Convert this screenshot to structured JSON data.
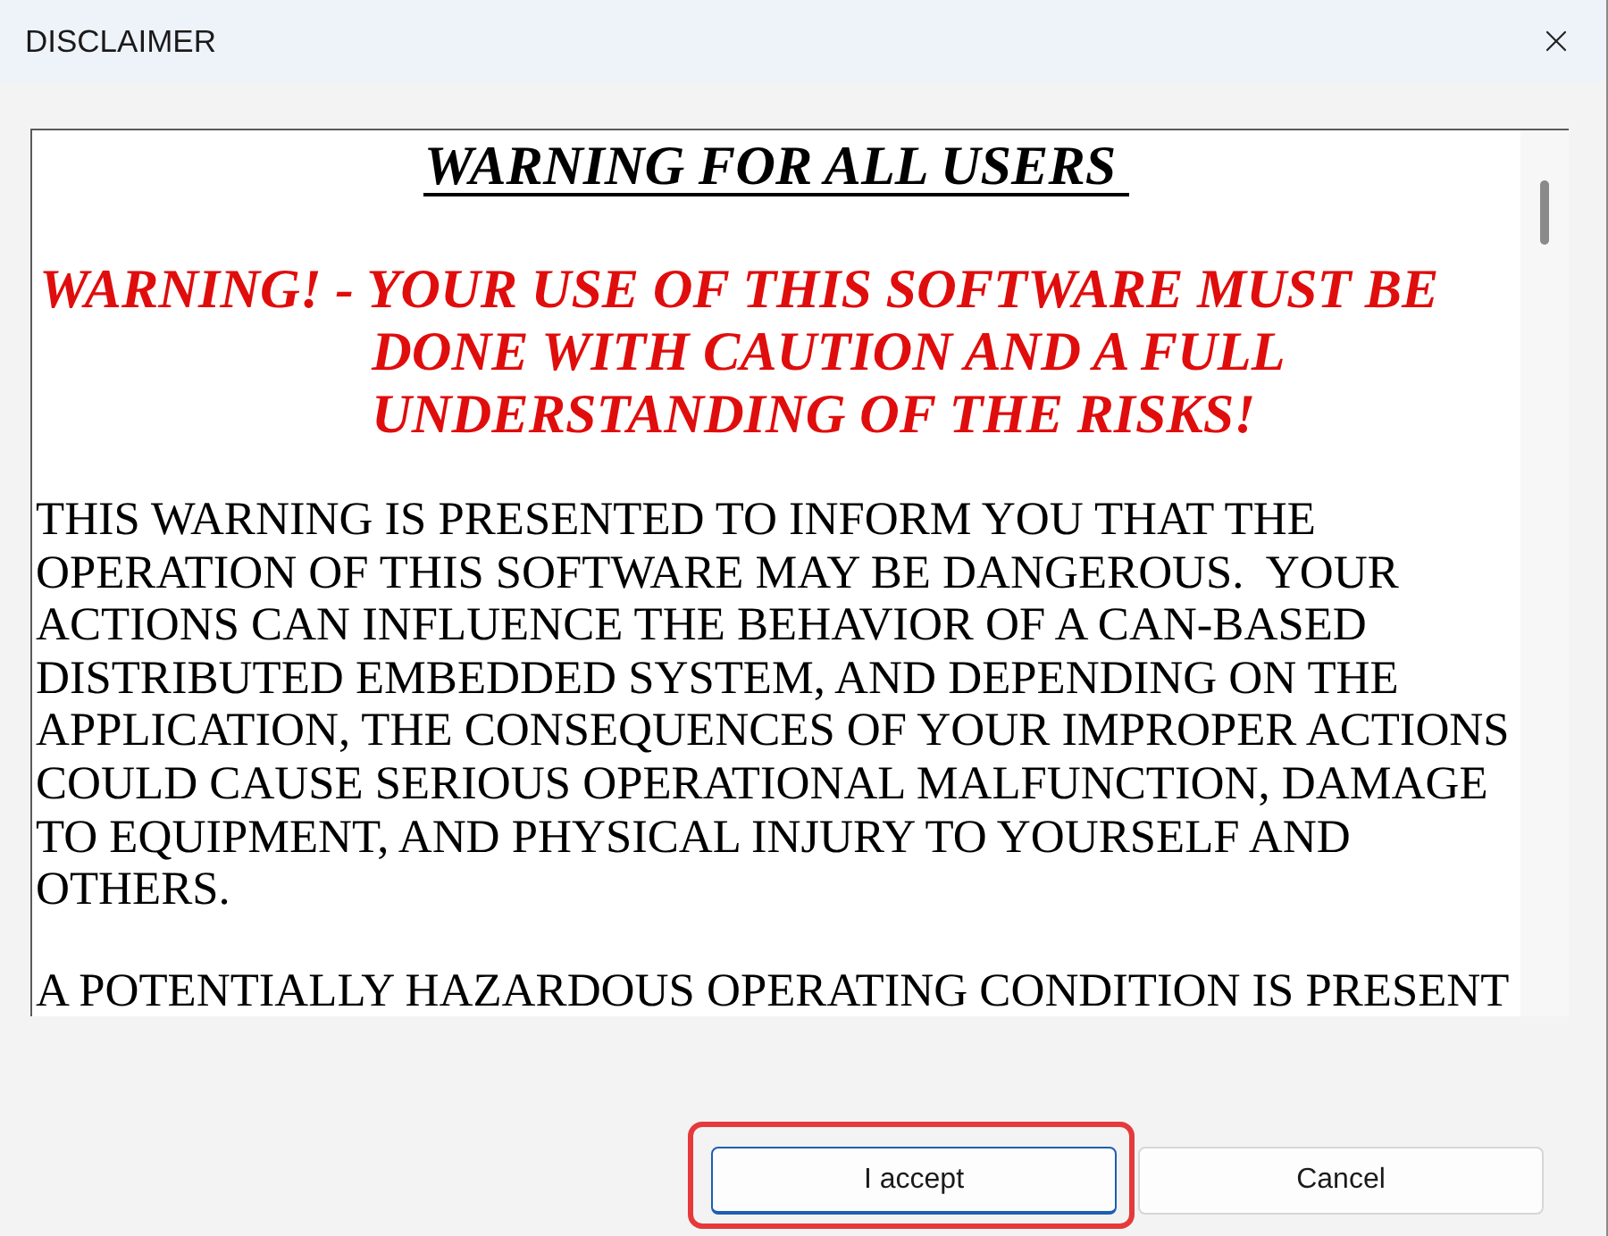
{
  "window": {
    "title": "DISCLAIMER"
  },
  "document": {
    "heading": "WARNING FOR ALL USERS",
    "warning": "WARNING! - YOUR USE OF THIS SOFTWARE MUST BE DONE WITH CAUTION AND A FULL UNDERSTANDING OF THE RISKS!",
    "paragraphs": [
      "THIS WARNING IS PRESENTED TO INFORM YOU THAT THE OPERATION OF THIS SOFTWARE MAY BE DANGEROUS.  YOUR ACTIONS CAN INFLUENCE THE BEHAVIOR OF A CAN-BASED DISTRIBUTED EMBEDDED SYSTEM, AND DEPENDING ON THE APPLICATION, THE CONSEQUENCES OF YOUR IMPROPER ACTIONS COULD CAUSE SERIOUS OPERATIONAL MALFUNCTION, DAMAGE TO EQUIPMENT, AND PHYSICAL INJURY TO YOURSELF AND OTHERS.",
      "A POTENTIALLY HAZARDOUS OPERATING CONDITION IS PRESENT"
    ]
  },
  "buttons": [
    {
      "label": "I accept",
      "default": true,
      "highlighted": true
    },
    {
      "label": "Cancel",
      "default": false,
      "highlighted": false
    }
  ]
}
